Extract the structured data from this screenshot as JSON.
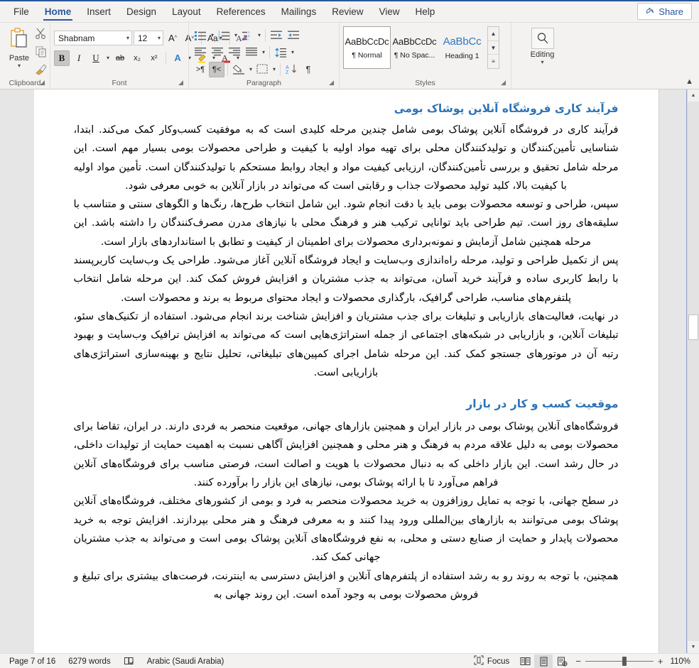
{
  "tabs": [
    {
      "label": "File",
      "active": false
    },
    {
      "label": "Home",
      "active": true
    },
    {
      "label": "Insert",
      "active": false
    },
    {
      "label": "Design",
      "active": false
    },
    {
      "label": "Layout",
      "active": false
    },
    {
      "label": "References",
      "active": false
    },
    {
      "label": "Mailings",
      "active": false
    },
    {
      "label": "Review",
      "active": false
    },
    {
      "label": "View",
      "active": false
    },
    {
      "label": "Help",
      "active": false
    }
  ],
  "share": {
    "label": "Share",
    "icon": "share-person-icon"
  },
  "ribbon": {
    "clipboard": {
      "group_label": "Clipboard",
      "paste_label": "Paste",
      "paste_icon": "clipboard-icon",
      "cut_icon": "scissors-icon",
      "copy_icon": "copy-icon",
      "format_painter_icon": "paintbrush-icon"
    },
    "font": {
      "group_label": "Font",
      "font_name": "Shabnam",
      "font_size": "12",
      "bold_label": "B",
      "italic_label": "I",
      "underline_label": "U",
      "strikethrough_label": "ab",
      "subscript_label": "x₂",
      "superscript_label": "x²",
      "grow_font_icon": "grow-font-icon",
      "shrink_font_icon": "shrink-font-icon",
      "change_case_label": "Aa",
      "clear_formatting_icon": "clear-formatting-icon",
      "text_effects_label": "A",
      "highlight_label": "highlight-icon",
      "font_color_label": "A",
      "bold_active": true
    },
    "paragraph": {
      "group_label": "Paragraph",
      "bullets_icon": "bullet-list-icon",
      "numbering_icon": "numbered-list-icon",
      "multilevel_icon": "multilevel-list-icon",
      "decrease_indent_icon": "decrease-indent-icon",
      "increase_indent_icon": "increase-indent-icon",
      "align_left_icon": "align-left-icon",
      "align_center_icon": "align-center-icon",
      "align_right_icon": "align-right-icon",
      "justify_icon": "justify-icon",
      "line_spacing_icon": "line-spacing-icon",
      "ltr_label": "ltr-text-direction-icon",
      "rtl_label": "rtl-text-direction-icon",
      "shading_icon": "shading-icon",
      "borders_icon": "borders-icon",
      "sort_icon": "sort-icon",
      "show_marks_icon": "show-paragraph-marks-icon",
      "rtl_active": true
    },
    "styles": {
      "group_label": "Styles",
      "items": [
        {
          "preview": "AaBbCcDc",
          "name": "¶ Normal",
          "selected": true,
          "heading": false
        },
        {
          "preview": "AaBbCcDc",
          "name": "¶ No Spac...",
          "selected": false,
          "heading": false
        },
        {
          "preview": "AaBbCc",
          "name": "Heading 1",
          "selected": false,
          "heading": true
        }
      ]
    },
    "editing": {
      "group_label": "",
      "label": "Editing",
      "icon": "search-icon"
    }
  },
  "document": {
    "sections": [
      {
        "heading": "فرآیند کاری فروشگاه آنلاین پوشاک بومی",
        "paragraphs": [
          "فرآیند کاری در فروشگاه آنلاین پوشاک بومی شامل چندین مرحله کلیدی است که به موفقیت کسب‌وکار کمک می‌کند. ابتدا، شناسایی تأمین‌کنندگان و تولیدکنندگان محلی برای تهیه مواد اولیه با کیفیت و طراحی محصولات بومی بسیار مهم است. این مرحله شامل تحقیق و بررسی تأمین‌کنندگان، ارزیابی کیفیت مواد و ایجاد روابط مستحکم با تولیدکنندگان است. تأمین مواد اولیه با کیفیت بالا، کلید تولید محصولات جذاب و رقابتی است که می‌تواند در بازار آنلاین به خوبی معرفی شود.",
          "سپس، طراحی و توسعه محصولات بومی باید با دقت انجام شود. این شامل انتخاب طرح‌ها، رنگ‌ها و الگوهای سنتی و متناسب با سلیقه‌های روز است. تیم طراحی باید توانایی ترکیب هنر و فرهنگ محلی با نیازهای مدرن مصرف‌کنندگان را داشته باشد. این مرحله همچنین شامل آزمایش و نمونه‌برداری محصولات برای اطمینان از کیفیت و تطابق با استانداردهای بازار است.",
          "پس از تکمیل طراحی و تولید، مرحله راه‌اندازی وب‌سایت و ایجاد فروشگاه آنلاین آغاز می‌شود. طراحی یک وب‌سایت کاربرپسند با رابط کاربری ساده و فرآیند خرید آسان، می‌تواند به جذب مشتریان و افزایش فروش کمک کند. این مرحله شامل انتخاب پلتفرم‌های مناسب، طراحی گرافیک، بارگذاری محصولات و ایجاد محتوای مربوط به برند و محصولات است.",
          "در نهایت، فعالیت‌های بازاریابی و تبلیغات برای جذب مشتریان و افزایش شناخت برند انجام می‌شود. استفاده از تکنیک‌های سئو، تبلیغات آنلاین، و بازاریابی در شبکه‌های اجتماعی از جمله استراتژی‌هایی است که می‌تواند به افزایش ترافیک وب‌سایت و بهبود رتبه آن در موتورهای جستجو کمک کند. این مرحله شامل اجرای کمپین‌های تبلیغاتی، تحلیل نتایج و بهینه‌سازی استراتژی‌های بازاریابی است."
        ]
      },
      {
        "heading": "موقعیت کسب و کار در بازار",
        "paragraphs": [
          "فروشگاه‌های آنلاین پوشاک بومی در بازار ایران و همچنین بازارهای جهانی، موقعیت منحصر به فردی دارند. در ایران، تقاضا برای محصولات بومی به دلیل علاقه مردم به فرهنگ و هنر محلی و همچنین افزایش آگاهی نسبت به اهمیت حمایت از تولیدات داخلی، در حال رشد است. این بازار داخلی که به دنبال محصولات با هویت و اصالت است، فرصتی مناسب برای فروشگاه‌های آنلاین فراهم می‌آورد تا با ارائه پوشاک بومی، نیازهای این بازار را برآورده کنند.",
          "در سطح جهانی، با توجه به تمایل روزافزون به خرید محصولات منحصر به فرد و بومی از کشورهای مختلف، فروشگاه‌های آنلاین پوشاک بومی می‌توانند به بازارهای بین‌المللی ورود پیدا کنند و به معرفی فرهنگ و هنر محلی بپردازند. افزایش توجه به خرید محصولات پایدار و حمایت از صنایع دستی و محلی، به نفع فروشگاه‌های آنلاین پوشاک بومی است و می‌تواند به جذب مشتریان جهانی کمک کند.",
          "همچنین، با توجه به روند رو به رشد استفاده از پلتفرم‌های آنلاین و افزایش دسترسی به اینترنت، فرصت‌های بیشتری برای تبلیغ و فروش محصولات بومی به وجود آمده است. این روند جهانی به"
        ]
      }
    ]
  },
  "statusbar": {
    "page_info": "Page 7 of 16",
    "word_count": "6279 words",
    "proofing_icon": "proofing-errors-icon",
    "language": "Arabic (Saudi Arabia)",
    "focus_label": "Focus",
    "focus_icon": "focus-mode-icon",
    "view_read_icon": "read-mode-icon",
    "view_print_icon": "print-layout-icon",
    "view_web_icon": "web-layout-icon",
    "zoom_out_label": "−",
    "zoom_in_label": "+",
    "zoom_value": "110%"
  },
  "colors": {
    "accent": "#2b579a",
    "heading": "#2e74b5",
    "ribbon_bg": "#f3f2f1",
    "doc_bg": "#e6e6e6"
  }
}
